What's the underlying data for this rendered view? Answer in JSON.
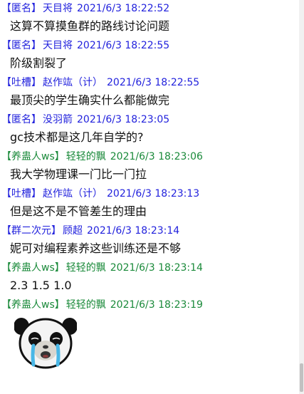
{
  "colors": {
    "blue": "#2222dd",
    "green": "#1a8a3a",
    "text": "#111111"
  },
  "messages": [
    {
      "tag": "【匿名】",
      "nick": "天目将",
      "time": "2021/6/3 18:22:52",
      "color": "#2222dd",
      "text": "这算不算摸鱼群的路线讨论问题"
    },
    {
      "tag": "【匿名】",
      "nick": "天目将",
      "time": "2021/6/3 18:22:55",
      "color": "#2222dd",
      "text": "阶级割裂了"
    },
    {
      "tag": "【吐槽】",
      "nick": "赵作竑（计）",
      "time": "2021/6/3 18:22:55",
      "color": "#2222dd",
      "text": "最顶尖的学生确实什么都能做完"
    },
    {
      "tag": "【匿名】",
      "nick": "没羽箭",
      "time": "2021/6/3 18:23:05",
      "color": "#2222dd",
      "text": "gc技术都是这几年自学的?"
    },
    {
      "tag": "【养蛊人ws】",
      "nick": "轻轻的飘",
      "time": "2021/6/3 18:23:06",
      "color": "#1a8a3a",
      "text": "我大学物理课一门比一门拉"
    },
    {
      "tag": "【吐槽】",
      "nick": "赵作竑（计）",
      "time": "2021/6/3 18:23:13",
      "color": "#2222dd",
      "text": "但是这不是不管差生的理由"
    },
    {
      "tag": "【群二次元】",
      "nick": "顾超",
      "time": "2021/6/3 18:23:14",
      "color": "#2222dd",
      "text": "妮可对编程素养这些训练还是不够"
    },
    {
      "tag": "【养蛊人ws】",
      "nick": "轻轻的飘",
      "time": "2021/6/3 18:23:14",
      "color": "#1a8a3a",
      "text": "2.3 1.5 1.0"
    },
    {
      "tag": "【养蛊人ws】",
      "nick": "轻轻的飘",
      "time": "2021/6/3 18:23:19",
      "color": "#1a8a3a",
      "image": "crying-panda-sticker"
    }
  ]
}
